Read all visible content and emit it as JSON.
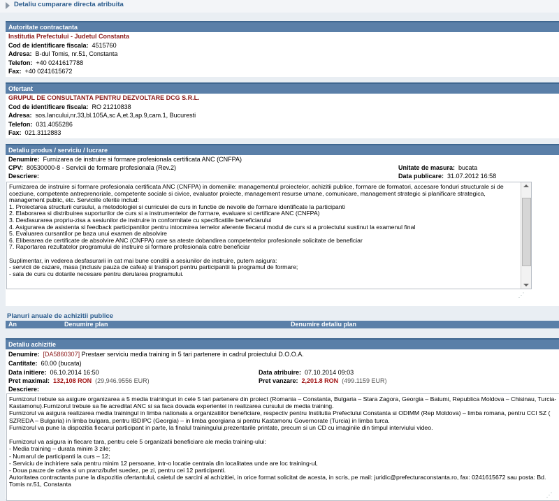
{
  "header": {
    "title": "Detaliu cumparare directa atribuita"
  },
  "autoritate": {
    "section_title": "Autoritate contractanta",
    "name": "Institutia Prefectului - Judetul Constanta",
    "cif_label": "Cod de identificare fiscala:",
    "cif": "4515760",
    "address_label": "Adresa:",
    "address": "B-dul Tomis, nr.51, Constanta",
    "phone_label": "Telefon:",
    "phone": "+40 0241617788",
    "fax_label": "Fax:",
    "fax": "+40 0241615672"
  },
  "ofertant": {
    "section_title": "Ofertant",
    "name": "GRUPUL DE CONSULTANTA PENTRU DEZVOLTARE DCG S.R.L.",
    "cif_label": "Cod de identificare fiscala:",
    "cif": "RO 21210838",
    "address_label": "Adresa:",
    "address": "sos.Iancului,nr.33,bl.105A,sc A,et.3,ap.9,cam.1, Bucuresti",
    "phone_label": "Telefon:",
    "phone": "031.4055286",
    "fax_label": "Fax:",
    "fax": "021.3112883"
  },
  "produs": {
    "section_title": "Detaliu produs / serviciu / lucrare",
    "denumire_label": "Denumire:",
    "denumire": "Furnizarea de instruire si formare profesionala certificata ANC (CNFPA)",
    "cpv_label": "CPV:",
    "cpv": "80530000-8 - Servicii de formare profesionala (Rev.2)",
    "um_label": "Unitate de masura:",
    "um": "bucata",
    "descriere_label": "Descriere:",
    "data_pub_label": "Data publicare:",
    "data_pub": "31.07.2012 16:58",
    "description_lines": [
      "Furnizarea de instruire si formare profesionala certificata ANC (CNFPA) in domeniile: managementul proiectelor, achizitii publice, formare de formatori, accesare fonduri structurale si de",
      "coeziune, competente antreprenoriale, competente sociale si civice, evaluator proiecte, management resurse umane, comunicare, management strategic si planificare strategica,",
      "management public, etc. Serviciile oferite includ:",
      "1. Proiectarea structurii cursului, a metodologiei si curriculei de curs in functie de nevoile de formare identificate la participanti",
      "2. Elaborarea si distribuirea suporturilor de curs si a instrumentelor de formare, evaluare si certificare ANC (CNFPA)",
      "3. Desfasurarea propriu-zisa a sesiunilor de instruire in conformitate cu specificatiile beneficiarului",
      "4. Asigurarea de asistenta si feedback participantilor pentru intocmirea temelor aferente fiecarui modul de curs si a proiectului sustinut la examenul final",
      "5. Evaluarea cursantilor pe baza unui examen de absolvire",
      "6. Eliberarea de certificate de absolvire ANC (CNFPA) care sa ateste dobandirea competentelor profesionale solicitate de beneficiar",
      "7. Raportarea rezultatelor programului de instruire si formare profesionala catre beneficiar",
      "",
      "Suplimentar, in vederea desfasurarii in cat mai bune conditii a sesiunilor de instruire, putem asigura:",
      "- servicii de cazare, masa (inclusiv pauza de cafea) si transport pentru participantii la programul de formare;",
      "- sala de curs cu dotarile necesare pentru derularea programului."
    ]
  },
  "planuri": {
    "title": "Planuri anuale de achizitii publice",
    "col_an": "An",
    "col_plan": "Denumire plan",
    "col_detaliu": "Denumire detaliu plan"
  },
  "achizitie": {
    "section_title": "Detaliu achizitie",
    "denumire_label": "Denumire:",
    "code": "[DA5860307]",
    "denumire": "Prestaer serviciu media training in 5 tari partenere in cadrul proiectului D.O.O.A.",
    "cantitate_label": "Cantitate:",
    "cantitate": "60.00 (bucata)",
    "data_init_label": "Data initiere:",
    "data_init": "06.10.2014 16:50",
    "data_atrib_label": "Data atribuire:",
    "data_atrib": "07.10.2014 09:03",
    "pret_max_label": "Pret maximal:",
    "pret_max": "132,108 RON",
    "pret_max_eur": "(29,946.9556 EUR)",
    "pret_vanz_label": "Pret vanzare:",
    "pret_vanz": "2,201.8 RON",
    "pret_vanz_eur": "(499.1159 EUR)",
    "descriere_label": "Descriere:",
    "description_lines": [
      "Furnizorul trebuie sa asigure organizarea a 5 media traininguri in cele 5 tari partenere  din proiect (Romania – Constanta, Bulgaria – Stara Zagora, Georgia – Batumi, Republica Moldova – Chisinau, Turcia-",
      "Kastamonu).Furnizorul trebuie sa fie acreditat ANC si sa faca dovada experientei in realizarea cursului de media training.",
      "Furnizorul va asigura realizarea media trainingul in limba nationala a organizatiilor beneficiare, respectiv pentru Institutia Prefectului Constanta si ODIMM (Rep Moldova) – limba romana, pentru CCI SZ (",
      "SZREDA – Bulgaria) in limba bulgara, pentru IBDIPC (Georgia) – in limba georgiana si pentru Kastamonu Governorate (Turcia) in limba turca.",
      "Furnizorul va pune la dispozitia fiecarui participant in parte, la finalul trainingului,prezentarile printate, precum si un CD cu imaginile din timpul interviului video.",
      "",
      "Furnizorul va asigura in fiecare tara, pentru cele 5 organizatii beneficiare ale media  training-ului:",
      "-        Media training – durata minim 3 zile;",
      "-        Numarul de participanti la curs – 12;",
      "-        Serviciu de inchiriere sala pentru minim 12 persoane, intr-o locatie centrala din localitatea unde are loc  training-ul,",
      "-        Doua pauze de cafea  si un pranz/bufet suedez, pe zi, pentru cei 12 participanti.",
      "Autoritatea contractanta pune la dispozitia ofertantului, caietul de sarcini al achizitiei, in orice format solicitat de acesta, in scris, pe mail: juridic@prefecturaconstanta.ro, fax: 0241615672 sau posta: Bd.",
      "Tomis nr.51, Constanta"
    ]
  }
}
